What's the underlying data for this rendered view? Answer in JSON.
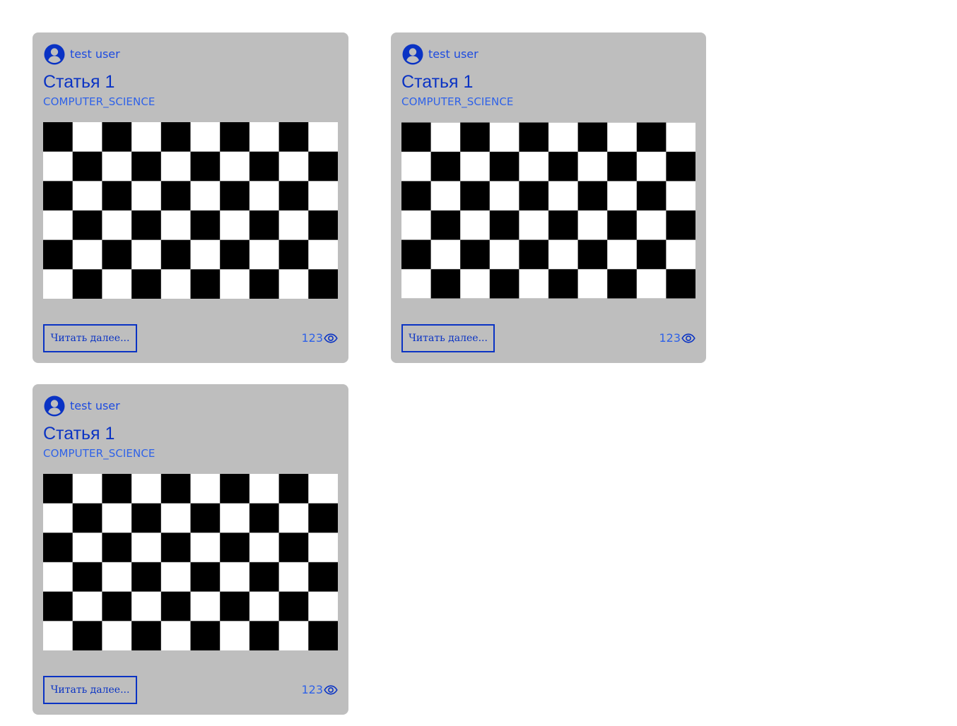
{
  "colors": {
    "card_background": "#bebebe",
    "accent": "#0a33c4",
    "link": "#2f62e8"
  },
  "icons": {
    "avatar": "user-circle-icon",
    "views": "eye-icon"
  },
  "articles": [
    {
      "author": "test user",
      "title": "Статья 1",
      "category": "COMPUTER_SCIENCE",
      "read_more_label": "Читать далее...",
      "views": "123"
    },
    {
      "author": "test user",
      "title": "Статья 1",
      "category": "COMPUTER_SCIENCE",
      "read_more_label": "Читать далее...",
      "views": "123"
    },
    {
      "author": "test user",
      "title": "Статья 1",
      "category": "COMPUTER_SCIENCE",
      "read_more_label": "Читать далее...",
      "views": "123"
    }
  ]
}
